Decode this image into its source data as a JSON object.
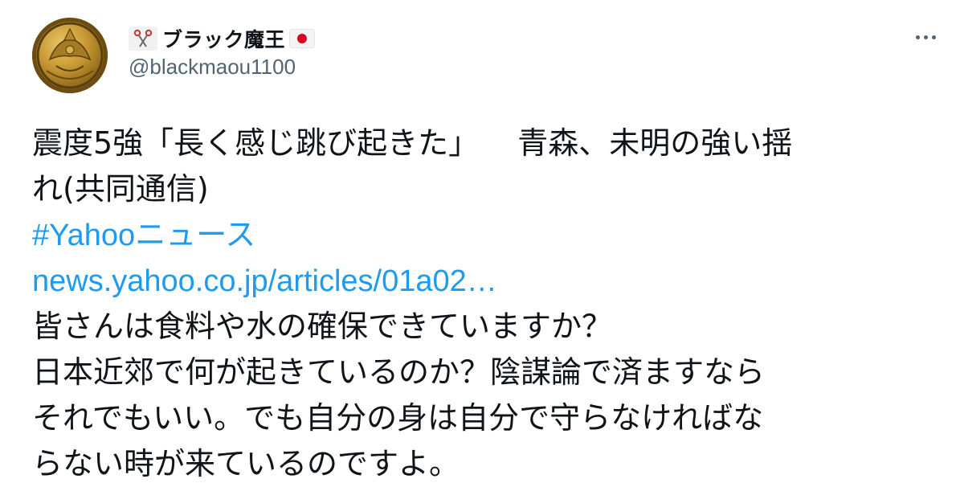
{
  "author": {
    "display_name": "ブラック魔王",
    "handle": "@blackmaou1100",
    "name_prefix_icon": "scissors-icon",
    "name_suffix_icon": "japan-flag-icon"
  },
  "colors": {
    "link": "#1d9bf0",
    "text": "#0f1419",
    "secondary": "#536471",
    "flag_red": "#d90021"
  },
  "tweet": {
    "headline_part1": "震度5強「長く感じ跳び起きた」",
    "headline_part2": "青森、未明の強い揺",
    "headline_part3": "れ(共同通信)",
    "hashtag": "#Yahooニュース",
    "link_text": "news.yahoo.co.jp/articles/01a02…",
    "body_lines": [
      "皆さんは食料や水の確保できていますか？",
      "日本近郊で何が起きているのか？陰謀論で済ますなら",
      "それでもいい。でも自分の身は自分で守らなければな",
      "らない時が来ているのですよ。"
    ]
  },
  "menu": {
    "more_icon": "more-horizontal-icon"
  }
}
